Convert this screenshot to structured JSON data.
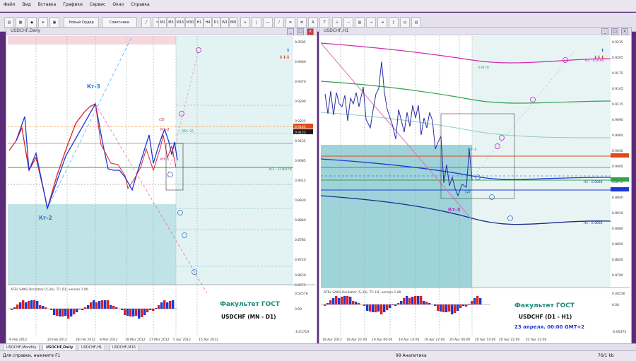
{
  "menu": [
    "Файл",
    "Вид",
    "Вставка",
    "Графики",
    "Сервис",
    "Окно",
    "Справка"
  ],
  "toolbar": {
    "new_order": "Новый Ордер",
    "advisors": "Советники",
    "timeframes": [
      "M1",
      "M5",
      "M15",
      "M30",
      "H1",
      "H4",
      "D1",
      "W1",
      "MN"
    ]
  },
  "left_window": {
    "title": "USDCHF,Daily",
    "labels": {
      "kt3": "Кт-3",
      "kt2": "Кт-2",
      "r2": "Кт-2",
      "r1": "Кт-1",
      "kt1": "(Кт-1)",
      "kt3b": "(3)",
      "level_right": "Б1 - 0.9076",
      "price1": "0.9145",
      "price2": "0.9123"
    },
    "price_ticks": [
      "0.9595",
      "0.9460",
      "0.9370",
      "0.9290",
      "0.9225",
      "0.9155",
      "0.9085",
      "0.9015",
      "0.8930",
      "0.8860",
      "0.8785",
      "0.8720",
      "0.8650",
      "0.8575"
    ],
    "date_ticks": [
      "9 Feb 2012",
      "20 Feb 2012",
      "28 Feb 2012",
      "8 Mar 2012",
      "18 Mar 2012",
      "27 Mar 2012",
      "5 Apr 2012",
      "15 Apr 2012"
    ],
    "oscillator_title": "ATEL SAKS Oscillator (5,34), TF: D1, version 1.00",
    "osc_ticks": [
      "0.02578",
      "0.00",
      "-0.01719"
    ],
    "faculty": "Факультет ГОСТ",
    "instrument": "USDCHF (MN - D1)"
  },
  "right_window": {
    "title": "USDCHF,H1",
    "labels": {
      "kt1": "Кт-1",
      "kt3": "Кт-3",
      "kt2": "(2)",
      "h1_top": "H1 - 0.9194",
      "h1_mid": "H1 - 0.9088",
      "h1_low": "H1 - 0.9066",
      "level_179": "0.9179"
    },
    "price_ticks": [
      "0.9235",
      "0.9205",
      "0.9175",
      "0.9145",
      "0.9115",
      "0.9090",
      "0.9060",
      "0.9030",
      "0.9000",
      "0.8970",
      "0.8940",
      "0.8910",
      "0.8880",
      "0.8850",
      "0.8820",
      "0.8790"
    ],
    "date_ticks": [
      "18 Apr 2012",
      "18 Apr 22:00",
      "19 Apr 06:00",
      "19 Apr 14:00",
      "19 Apr 22:00",
      "20 Apr 06:00",
      "20 Apr 14:00",
      "20 Apr 22:00",
      "22 Apr 22:00"
    ],
    "oscillator_title": "ATEL SAKS Oscillator (5,34), TF: H1, version 1.00",
    "osc_ticks": [
      "0.00256",
      "0.00",
      "-0.00372"
    ],
    "faculty": "Факультет ГОСТ",
    "instrument": "USDCHF (D1 - H1)",
    "date_note": "23 апреля. 00:00 GMT+2"
  },
  "tabs": [
    "USDCHF,Monthly",
    "USDCHF,Daily",
    "USDCHF,H1",
    "USDCHF,M15"
  ],
  "status": {
    "help": "Для справки, нажмите F1",
    "center": "99 Аналитика",
    "right": "76/1 kb"
  },
  "colors": {
    "accent": "#1a4fd6",
    "red": "#e02020",
    "teal": "#1b7a8a",
    "magenta": "#d02ab0"
  }
}
